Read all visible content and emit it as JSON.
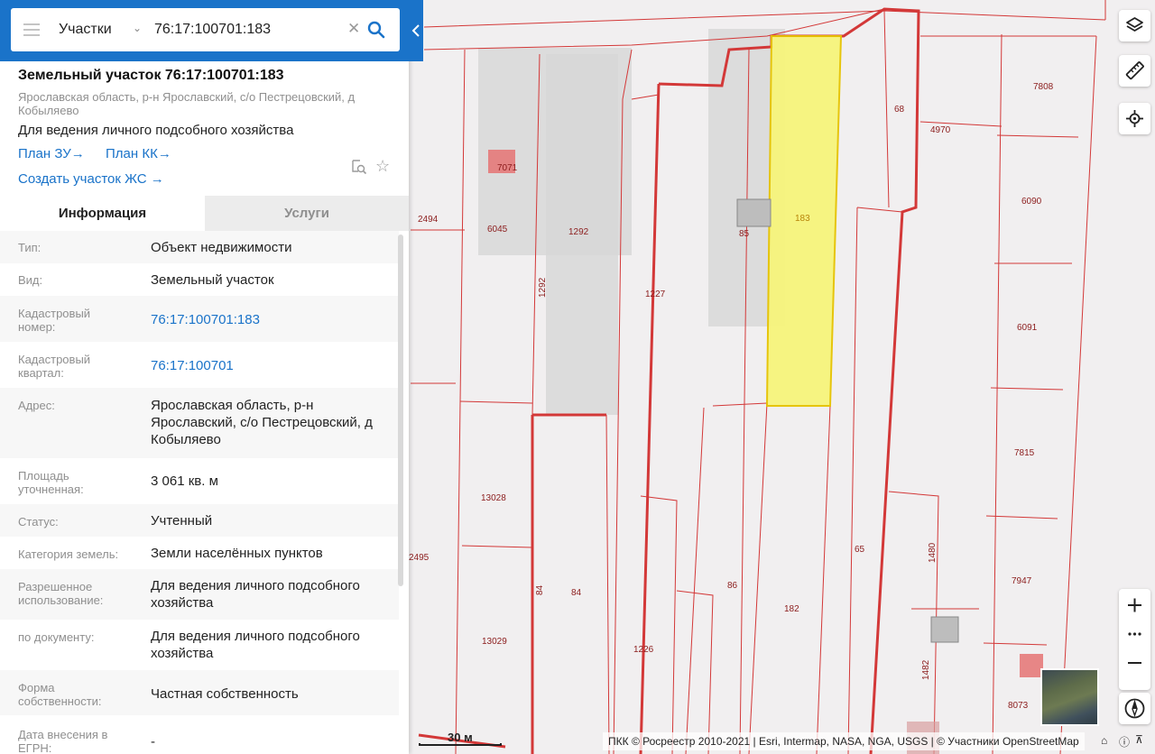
{
  "search": {
    "type_label": "Участки",
    "query": "76:17:100701:183"
  },
  "card": {
    "title": "Земельный участок 76:17:100701:183",
    "subaddress": "Ярославская область, р-н Ярославский, с/о Пестрецовский, д Кобыляево",
    "purpose": "Для ведения личного подсобного хозяйства",
    "links": {
      "plan_zu": "План ЗУ",
      "plan_kk": "План КК",
      "create": "Создать участок ЖС",
      "arrow": "→"
    }
  },
  "tabs": {
    "info": "Информация",
    "services": "Услуги"
  },
  "rows": [
    {
      "label": "Тип:",
      "value": "Объект недвижимости"
    },
    {
      "label": "Вид:",
      "value": "Земельный участок"
    },
    {
      "label": "Кадастровый номер:",
      "value": "76:17:100701:183"
    },
    {
      "label": "Кадастровый квартал:",
      "value": "76:17:100701"
    },
    {
      "label": "Адрес:",
      "value": "Ярославская область, р-н Ярославский, с/о Пестрецовский, д Кобыляево"
    },
    {
      "label": "Площадь уточненная:",
      "value": "3 061 кв. м"
    },
    {
      "label": "Статус:",
      "value": "Учтенный"
    },
    {
      "label": "Категория земель:",
      "value": "Земли населённых пунктов"
    },
    {
      "label": "Разрешенное использование:",
      "value": "Для ведения личного подсобного хозяйства"
    },
    {
      "label": "по документу:",
      "value": "Для ведения личного подсобного хозяйства"
    },
    {
      "label": "Форма собственности:",
      "value": "Частная собственность"
    },
    {
      "label": "Дата внесения в ЕГРН:",
      "value": "-"
    }
  ],
  "map": {
    "plot_labels": {
      "l7071": "7071",
      "l2494": "2494",
      "l6045": "6045",
      "l1292a": "1292",
      "l1292b": "1292",
      "l85": "85",
      "l183": "183",
      "l1227": "1227",
      "l68": "68",
      "l4970": "4970",
      "l7808": "7808",
      "l6090": "6090",
      "l6091": "6091",
      "l7815": "7815",
      "l13028": "13028",
      "l2495": "2495",
      "l65": "65",
      "l1480": "1480",
      "l7947": "7947",
      "l84a": "84",
      "l84b": "84",
      "l86": "86",
      "l182": "182",
      "l13029": "13029",
      "l1226": "1226",
      "l1482": "1482",
      "l8073": "8073"
    },
    "scale": "30 м",
    "attribution": "ПКК © Росреестр 2010-2021 | Esri, Intermap, NASA, NGA, USGS | © Участники OpenStreetMap",
    "colors": {
      "selected_fill": "#f7f57c",
      "selected_stroke": "#e6c300",
      "boundary": "#d33838",
      "building_fill": "#cfcfcf",
      "accent": "#1a73c9"
    }
  }
}
